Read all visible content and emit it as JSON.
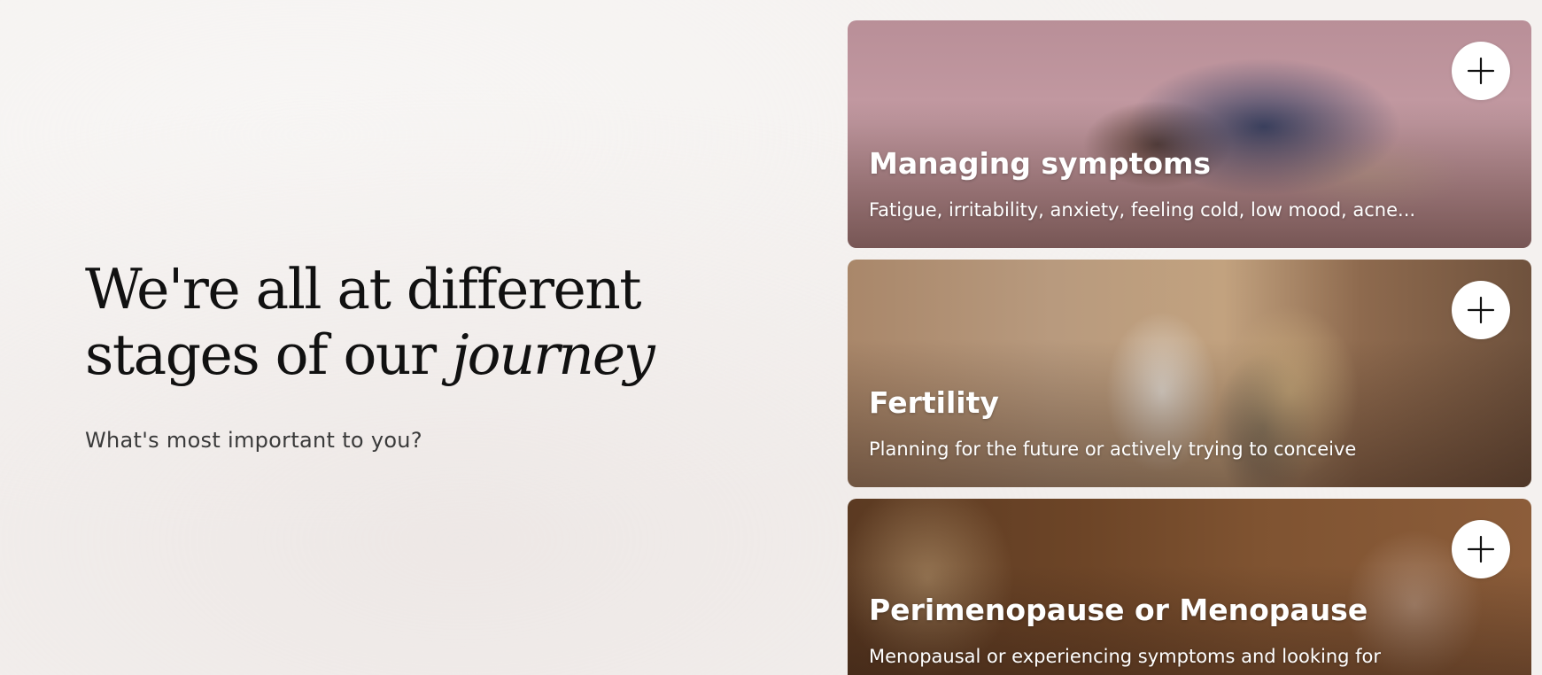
{
  "intro": {
    "headline_line1": "We're all at different",
    "headline_line2_prefix": "stages of our",
    "headline_line2_accent": "journey",
    "subheading": "What's most important to you?"
  },
  "cards": [
    {
      "title": "Managing symptoms",
      "description": "Fatigue, irritability, anxiety, feeling cold, low mood, acne...",
      "icon": "plus-icon"
    },
    {
      "title": "Fertility",
      "description": "Planning for the future or actively trying to conceive",
      "icon": "plus-icon"
    },
    {
      "title": "Perimenopause or Menopause",
      "description": "Menopausal or experiencing symptoms and looking for",
      "icon": "plus-icon"
    }
  ],
  "colors": {
    "page_background": "#f4f1ef",
    "heading_text": "#111111",
    "body_text": "#3a3a3a",
    "card_text": "#ffffff",
    "button_background": "#ffffff",
    "button_icon": "#111111"
  }
}
